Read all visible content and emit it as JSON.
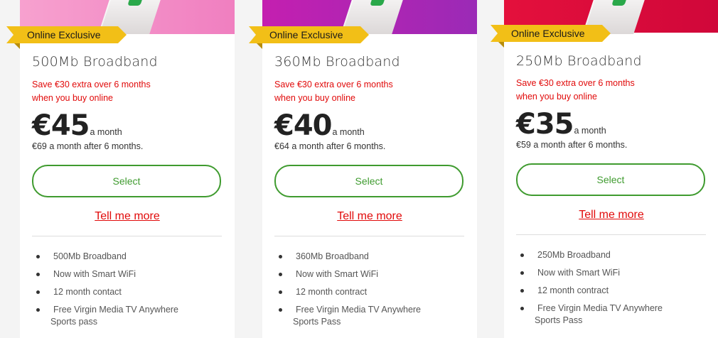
{
  "cards": [
    {
      "badge": "Online Exclusive",
      "title": "500Mb Broadband",
      "promo_line1": "Save €30 extra over 6 months",
      "promo_line2": "when you buy online",
      "price": "€45",
      "price_unit": "a month",
      "after_price": "€69 a month after 6 months.",
      "select_label": "Select",
      "more_label": "Tell me more",
      "features": [
        "500Mb Broadband",
        "Now with Smart WiFi",
        "12 month contact"
      ],
      "feature_last_line1": "Free Virgin Media TV Anywhere",
      "feature_last_line2": "Sports pass",
      "banner_color_start": "#f7a1cf",
      "banner_color_end": "#f07fc0"
    },
    {
      "badge": "Online Exclusive",
      "title": "360Mb Broadband",
      "promo_line1": "Save €30 extra over 6 months",
      "promo_line2": "when you buy online",
      "price": "€40",
      "price_unit": "a month",
      "after_price": "€64 a month after 6 months.",
      "select_label": "Select",
      "more_label": "Tell me more",
      "features": [
        "360Mb Broadband",
        "Now with Smart WiFi",
        "12 month contract"
      ],
      "feature_last_line1": "Free Virgin Media TV Anywhere",
      "feature_last_line2": "Sports Pass",
      "banner_color_start": "#c41fb0",
      "banner_color_end": "#9b2ab6"
    },
    {
      "badge": "Online Exclusive",
      "title": "250Mb Broadband",
      "promo_line1": "Save €30 extra over 6 months",
      "promo_line2": "when you buy online",
      "price": "€35",
      "price_unit": "a month",
      "after_price": "€59 a month after 6 months.",
      "select_label": "Select",
      "more_label": "Tell me more",
      "features": [
        "250Mb Broadband",
        "Now with Smart WiFi",
        "12 month contract"
      ],
      "feature_last_line1": "Free Virgin Media TV Anywhere",
      "feature_last_line2": "Sports Pass",
      "banner_color_start": "#e4103c",
      "banner_color_end": "#d0073a"
    }
  ],
  "colors": {
    "accent_red": "#e10a0a",
    "select_green": "#3f9b2f",
    "badge_yellow": "#f2bf17"
  }
}
